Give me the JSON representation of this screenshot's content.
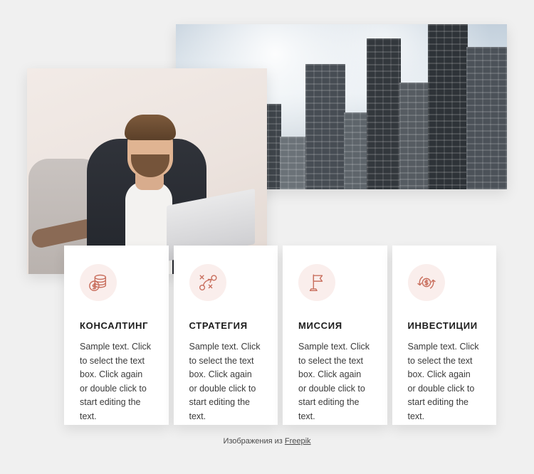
{
  "page": {
    "background_color": "#f0f0f0",
    "accent_color": "#c9705f",
    "icon_circle_color": "#faeeec"
  },
  "media": [
    {
      "name": "city-skyscrapers-photo",
      "alt": "Glass skyscrapers viewed from below against a cloudy sky"
    },
    {
      "name": "businessman-laptop-photo",
      "alt": "Bearded businessman in a dark blazer working on a laptop"
    }
  ],
  "cards": [
    {
      "icon": "coins-stack-icon",
      "title": "КОНСАЛТИНГ",
      "text": "Sample text. Click to select the text box. Click again or double click to start editing the text."
    },
    {
      "icon": "strategy-playbook-icon",
      "title": "СТРАТЕГИЯ",
      "text": "Sample text. Click to select the text box. Click again or double click to start editing the text."
    },
    {
      "icon": "flag-icon",
      "title": "МИССИЯ",
      "text": "Sample text. Click to select the text box. Click again or double click to start editing the text."
    },
    {
      "icon": "money-exchange-icon",
      "title": "ИНВЕСТИЦИИ",
      "text": "Sample text. Click to select the text box. Click again or double click to start editing the text."
    }
  ],
  "footer": {
    "prefix": "Изображения из ",
    "link_label": "Freepik"
  }
}
